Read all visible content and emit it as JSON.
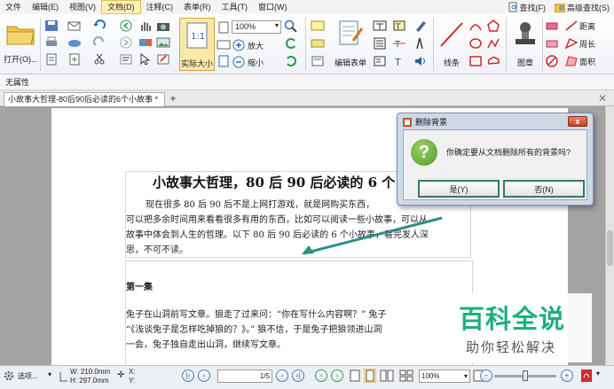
{
  "menu": {
    "items": [
      {
        "label": "文件"
      },
      {
        "label": "编辑(E)"
      },
      {
        "label": "视图(V)"
      },
      {
        "label": "文档(D)",
        "active": true
      },
      {
        "label": "注释(C)"
      },
      {
        "label": "表单(R)"
      },
      {
        "label": "工具(T)"
      },
      {
        "label": "窗口(W)"
      }
    ],
    "search_label": "查找(F)",
    "advanced_search_label": "高级查找(S)"
  },
  "toolbar": {
    "open_label": "打开(O)...",
    "zoom_value": "100%",
    "zoom_in_label": "放大",
    "zoom_out_label": "缩小",
    "actual_size_label": "实际大小",
    "edit_form_label": "编辑表单",
    "lines_label": "线条",
    "stamp_label": "图章",
    "distance_label": "距离",
    "perimeter_label": "周长",
    "area_label": "面积"
  },
  "properties_bar": {
    "label": "无属性"
  },
  "tabs": {
    "doc_tab_label": "小故事大哲理-80后90后必读的6个小故事 *",
    "add_label": "+"
  },
  "document": {
    "title": "小故事大哲理，80 后 90 后必读的 6 个",
    "para1": [
      "现在很多 80 后 90 后不是上网打游戏，就是网购买东西，",
      "可以把多余时间用来看看很多有用的东西，比如可以阅读一些小故事，可以从",
      "故事中体会到人生的哲理。以下 80 后 90 后必读的 6 个小故事，看完发人深",
      "思，不可不读。"
    ],
    "section_title": "第一集",
    "para2": [
      "兔子在山洞前写文章。狼走了过来问：“你在写什么内容啊？” 兔子",
      "“《浅谈兔子是怎样吃掉狼的？》。” 狼不信，于是兔子把狼领进山洞",
      "一会，兔子独自走出山洞，继续写文章。"
    ]
  },
  "dialog": {
    "title": "删除背景",
    "message": "你确定要从文档删除所有的背景吗?",
    "yes_label": "是(Y)",
    "no_label": "否(N)",
    "close_label": "x",
    "icon_glyph": "?"
  },
  "watermark": {
    "main": "百科全说",
    "sub": "助你轻松解决"
  },
  "status": {
    "options_label": "选项...",
    "width_label": "W: 210.0mm",
    "height_label": "H: 297.0mm",
    "x_label": "X:",
    "y_label": "Y:",
    "page_value": "1/5",
    "zoom_value": "100%"
  },
  "colors": {
    "accent": "#1eb07a",
    "dialog_border": "#2f7d67",
    "arrow": "#2a8f86"
  }
}
